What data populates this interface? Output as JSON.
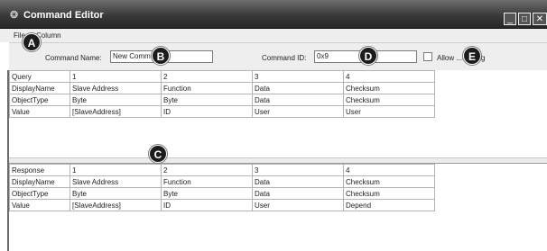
{
  "window": {
    "title": "Command Editor"
  },
  "window_controls": {
    "minimize": "_",
    "maximize": "□",
    "close": "✕"
  },
  "menu": {
    "file": "File",
    "column": "Column"
  },
  "toolbar": {
    "command_name_label": "Command Name:",
    "command_name_value": "New Comm",
    "command_id_label": "Command ID:",
    "command_id_value": "0x9",
    "allow_label": "Allow ...casting"
  },
  "query_table": {
    "rows": [
      [
        "Query",
        "1",
        "2",
        "3",
        "4"
      ],
      [
        "DisplayName",
        "Slave Address",
        "Function",
        "Data",
        "Checksum"
      ],
      [
        "ObjectType",
        "Byte",
        "Byte",
        "Data",
        "Checksum"
      ],
      [
        "Value",
        "[SlaveAddress]",
        "ID",
        "User",
        "User"
      ]
    ]
  },
  "response_table": {
    "rows": [
      [
        "Response",
        "1",
        "2",
        "3",
        "4"
      ],
      [
        "DisplayName",
        "Slave Address",
        "Function",
        "Data",
        "Checksum"
      ],
      [
        "ObjectType",
        "Byte",
        "Byte",
        "Data",
        "Checksum"
      ],
      [
        "Value",
        "[SlaveAddress]",
        "ID",
        "User",
        "Depend"
      ]
    ]
  },
  "callouts": {
    "a": "A",
    "b": "B",
    "c": "C",
    "d": "D",
    "e": "E"
  },
  "icons": {
    "app": "gear-icon"
  }
}
